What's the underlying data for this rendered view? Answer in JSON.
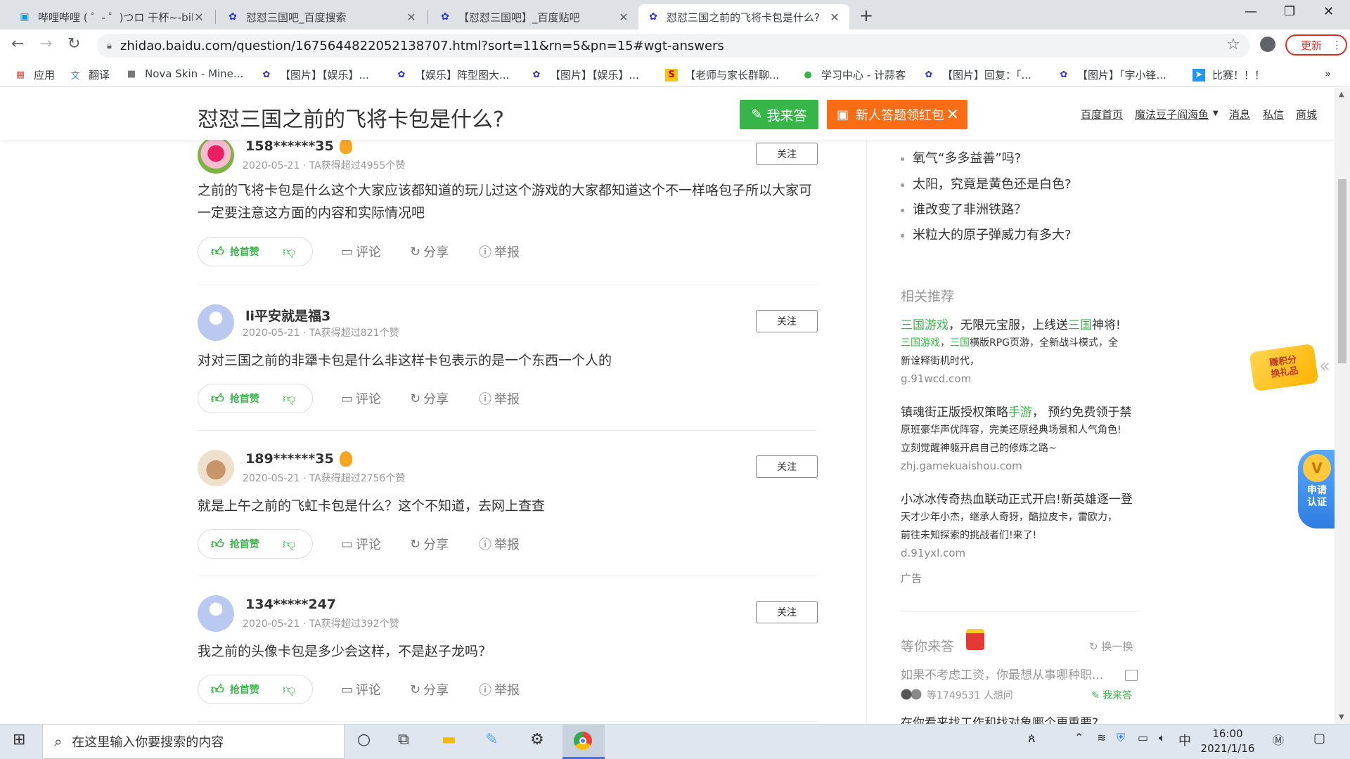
{
  "browser": {
    "tabs": [
      {
        "title": "哔哩哔哩 ( ゜- ゜)つロ 干杯~-bili",
        "icon": "bilibili-icon"
      },
      {
        "title": "怼怼三国吧_百度搜索",
        "icon": "baidu-paw-icon"
      },
      {
        "title": "【怼怼三国吧】_百度贴吧",
        "icon": "baidu-paw-icon"
      },
      {
        "title": "怼怼三国之前的飞将卡包是什么?",
        "icon": "baidu-paw-icon"
      }
    ],
    "url": "zhidao.baidu.com/question/1675644822052138707.html?sort=11&rn=5&pn=15#wgt-answers",
    "update_label": "更新",
    "bookmarks": [
      {
        "label": "应用",
        "icon": "apps-grid-icon"
      },
      {
        "label": "翻译",
        "icon": "translate-icon"
      },
      {
        "label": "Nova Skin - Mine...",
        "icon": "cube-icon"
      },
      {
        "label": "【图片】【娱乐】...",
        "icon": "baidu-paw-icon"
      },
      {
        "label": "【娱乐】阵型图大...",
        "icon": "baidu-paw-icon"
      },
      {
        "label": "【图片】【娱乐】...",
        "icon": "baidu-paw-icon"
      },
      {
        "label": "【老师与家长群聊...",
        "icon": "sogou-icon"
      },
      {
        "label": "学习中心 - 计蒜客",
        "icon": "jisuanke-icon"
      },
      {
        "label": "【图片】回复：「...",
        "icon": "baidu-paw-icon"
      },
      {
        "label": "【图片】「宇小锋...",
        "icon": "baidu-paw-icon"
      },
      {
        "label": "比赛！！！",
        "icon": "send-icon"
      }
    ]
  },
  "header": {
    "title": "怼怼三国之前的飞将卡包是什么?",
    "answer_btn": "我来答",
    "redpack_btn": "新人答题领红包",
    "links": [
      "百度首页",
      "魔法豆子阎海鱼",
      "消息",
      "私信",
      "商城"
    ]
  },
  "actions": {
    "like": "抢首赞",
    "comment": "评论",
    "share": "分享",
    "report": "举报",
    "follow": "关注"
  },
  "answers": [
    {
      "user": "158******35",
      "meta": "2020-05-21 · TA获得超过4955个赞",
      "content": "之前的飞将卡包是什么这个大家应该都知道的玩儿过这个游戏的大家都知道这个不一样咯包子所以大家可一定要注意这方面的内容和实际情况吧"
    },
    {
      "user": "li平安就是福3",
      "meta": "2020-05-21 · TA获得超过821个赞",
      "content": "对对三国之前的非犟卡包是什么非这样卡包表示的是一个东西一个人的"
    },
    {
      "user": "189******35",
      "meta": "2020-05-21 · TA获得超过2756个赞",
      "content": "就是上午之前的飞虹卡包是什么？这个不知道，去网上查查"
    },
    {
      "user": "134*****247",
      "meta": "2020-05-21 · TA获得超过392个赞",
      "content": "我之前的头像卡包是多少会这样，不是赵子龙吗？"
    }
  ],
  "sidebar": {
    "questions": [
      "氧气“多多益善”吗?",
      "太阳，究竟是黄色还是白色?",
      "谁改变了非洲铁路？",
      "米粒大的原子弹威力有多大?"
    ],
    "related_title": "相关推荐",
    "ads": [
      {
        "title_hl": "三国游戏",
        "title_rest": "，无限元宝服，上线送",
        "title_hl2": "三国",
        "title_end": "神将!",
        "line1_hl": "三国游戏",
        "line1_rest": "，",
        "line1_hl2": "三国",
        "line1_end": "横版RPG页游，全新战斗模式，全",
        "line2": "新诠释街机时代，",
        "url": "g.91wcd.com"
      },
      {
        "title_hl": "",
        "title_rest": "镇魂街正版授权策略",
        "title_hl2": "手游",
        "title_end": "， 预约免费领于禁",
        "line1_hl": "",
        "line1_rest": "原班豪华声优阵容，完美还原经典场景和人气角色!",
        "line1_hl2": "",
        "line1_end": "",
        "line2": "立刻觉醒神躯开启自己的修炼之路~",
        "url": "zhj.gamekuaishou.com"
      },
      {
        "title_hl": "",
        "title_rest": "小冰冰传奇热血联动正式开启!新英雄逐一登",
        "title_hl2": "",
        "title_end": "",
        "line1_hl": "",
        "line1_rest": "天才少年小杰，继承人奇犽，酷拉皮卡，雷欧力，",
        "line1_hl2": "",
        "line1_end": "",
        "line2": "前往未知探索的挑战者们!来了!",
        "url": "d.91yxl.com"
      }
    ],
    "ad_label": "广告",
    "waiting_title": "等你来答",
    "refresh": "换一换",
    "waiting_q1": "如果不考虑工资，你最想从事哪种职...",
    "waiting_count": "等1749531 人想问",
    "waiting_answer": "我来答",
    "waiting_q2": "在你看来找工作和找对象哪个更重要?",
    "float_points": "赚积分\n换礼品",
    "float_cert": "申请\n认证"
  },
  "taskbar": {
    "search_placeholder": "在这里输入你要搜索的内容",
    "ime": "中",
    "time": "16:00",
    "date": "2021/1/16"
  }
}
